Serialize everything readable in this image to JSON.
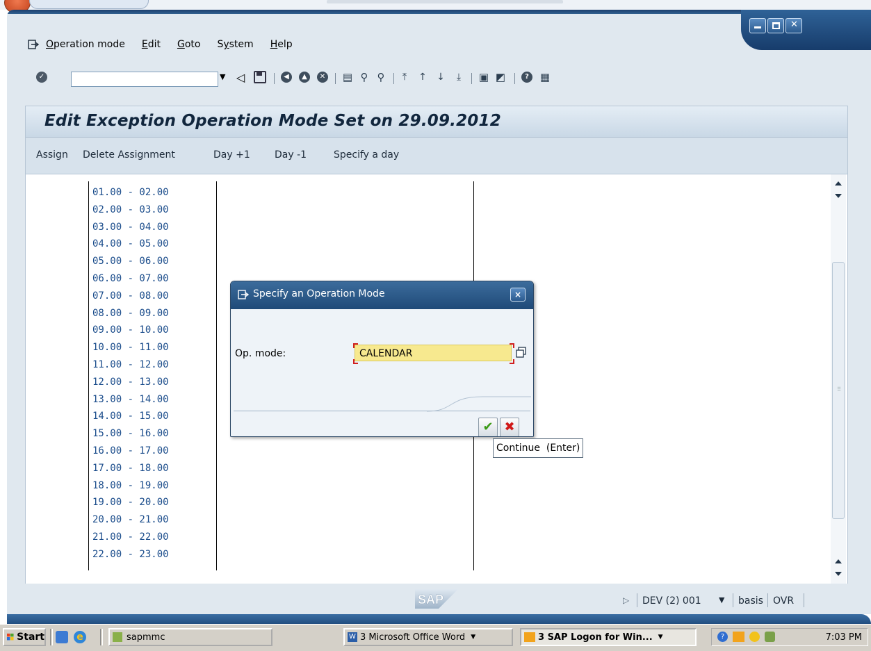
{
  "menu": {
    "items": [
      "Operation mode",
      "Edit",
      "Goto",
      "System",
      "Help"
    ],
    "underline": [
      "O",
      "E",
      "G",
      "y",
      "H"
    ]
  },
  "page": {
    "title": "Edit Exception Operation Mode Set on 29.09.2012"
  },
  "app_toolbar": [
    "Assign",
    "Delete Assignment",
    "Day +1",
    "Day -1",
    "Specify a day"
  ],
  "time_slots": [
    "01.00 - 02.00",
    "02.00 - 03.00",
    "03.00 - 04.00",
    "04.00 - 05.00",
    "05.00 - 06.00",
    "06.00 - 07.00",
    "07.00 - 08.00",
    "08.00 - 09.00",
    "09.00 - 10.00",
    "10.00 - 11.00",
    "11.00 - 12.00",
    "12.00 - 13.00",
    "13.00 - 14.00",
    "14.00 - 15.00",
    "15.00 - 16.00",
    "16.00 - 17.00",
    "17.00 - 18.00",
    "18.00 - 19.00",
    "19.00 - 20.00",
    "20.00 - 21.00",
    "21.00 - 22.00",
    "22.00 - 23.00"
  ],
  "dialog": {
    "title": "Specify an Operation Mode",
    "close_glyph": "×",
    "op_mode_label": "Op. mode:",
    "op_mode_value": "CALENDAR",
    "ok_glyph": "✔",
    "cancel_glyph": "✖"
  },
  "tooltip": "Continue  (Enter)",
  "statusbar": {
    "logo": "SAP",
    "system": "DEV (2) 001",
    "user": "basis",
    "mode": "OVR"
  },
  "taskbar": {
    "start": "Start",
    "tasks": [
      "sapmmc",
      "3 Microsoft Office Word",
      "3 SAP Logon for Win..."
    ],
    "clock": "7:03 PM"
  },
  "colors": {
    "title_text": "#11263d",
    "time_slot_text": "#1a4c8b",
    "input_bg": "#f7e98f",
    "dialog_header": "#2a5685"
  }
}
